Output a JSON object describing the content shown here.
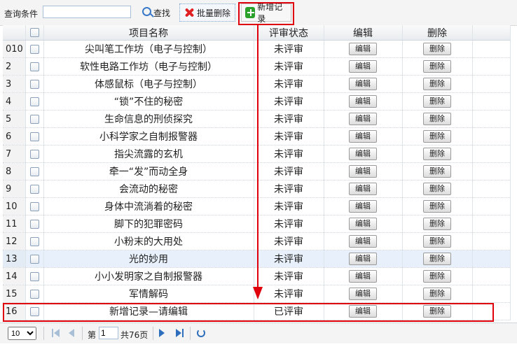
{
  "toolbar": {
    "query_label": "查询条件",
    "query_value": "",
    "search_label": "查找",
    "batch_delete_label": "批量删除",
    "add_label": "新增记录",
    "icons": {
      "search": "search-icon",
      "batch_delete": "delete-x-icon",
      "add": "plus-icon"
    }
  },
  "table": {
    "headers": {
      "name": "项目名称",
      "status": "评审状态",
      "edit": "编辑",
      "delete": "删除"
    },
    "rows": [
      {
        "num": "010",
        "name": "尖叫笔工作坊（电子与控制）",
        "status": "未评审",
        "edit": "编辑",
        "del": "删除"
      },
      {
        "num": "2",
        "name": "软性电路工作坊（电子与控制）",
        "status": "未评审",
        "edit": "编辑",
        "del": "删除"
      },
      {
        "num": "3",
        "name": "体感鼠标（电子与控制）",
        "status": "未评审",
        "edit": "编辑",
        "del": "删除"
      },
      {
        "num": "4",
        "name": "“锁”不住的秘密",
        "status": "未评审",
        "edit": "编辑",
        "del": "删除"
      },
      {
        "num": "5",
        "name": "生命信息的刑侦探究",
        "status": "未评审",
        "edit": "编辑",
        "del": "删除"
      },
      {
        "num": "6",
        "name": "小科学家之自制报警器",
        "status": "未评审",
        "edit": "编辑",
        "del": "删除"
      },
      {
        "num": "7",
        "name": "指尖流露的玄机",
        "status": "未评审",
        "edit": "编辑",
        "del": "删除"
      },
      {
        "num": "8",
        "name": "牵一“发”而动全身",
        "status": "未评审",
        "edit": "编辑",
        "del": "删除"
      },
      {
        "num": "9",
        "name": "会流动的秘密",
        "status": "未评审",
        "edit": "编辑",
        "del": "删除"
      },
      {
        "num": "10",
        "name": "身体中流淌着的秘密",
        "status": "未评审",
        "edit": "编辑",
        "del": "删除"
      },
      {
        "num": "11",
        "name": "脚下的犯罪密码",
        "status": "未评审",
        "edit": "编辑",
        "del": "删除"
      },
      {
        "num": "12",
        "name": "小粉末的大用处",
        "status": "未评审",
        "edit": "编辑",
        "del": "删除"
      },
      {
        "num": "13",
        "name": "光的妙用",
        "status": "未评审",
        "edit": "编辑",
        "del": "删除"
      },
      {
        "num": "14",
        "name": "小小发明家之自制报警器",
        "status": "未评审",
        "edit": "编辑",
        "del": "删除"
      },
      {
        "num": "15",
        "name": "军情解码",
        "status": "未评审",
        "edit": "编辑",
        "del": "删除"
      },
      {
        "num": "16",
        "name": "新增记录—请编辑",
        "status": "已评审",
        "edit": "编辑",
        "del": "删除"
      }
    ],
    "selected_row": 13
  },
  "pager": {
    "page_size": "10",
    "page_prefix": "第",
    "current_page": "1",
    "page_suffix": "共76页",
    "icons": [
      "first-page-icon",
      "prev-page-icon",
      "next-page-icon",
      "last-page-icon",
      "refresh-icon"
    ]
  },
  "colors": {
    "highlight": "#e0000b",
    "accent": "#2d6fbd",
    "add_icon": "#2aa12a",
    "delete_icon": "#e02020"
  }
}
